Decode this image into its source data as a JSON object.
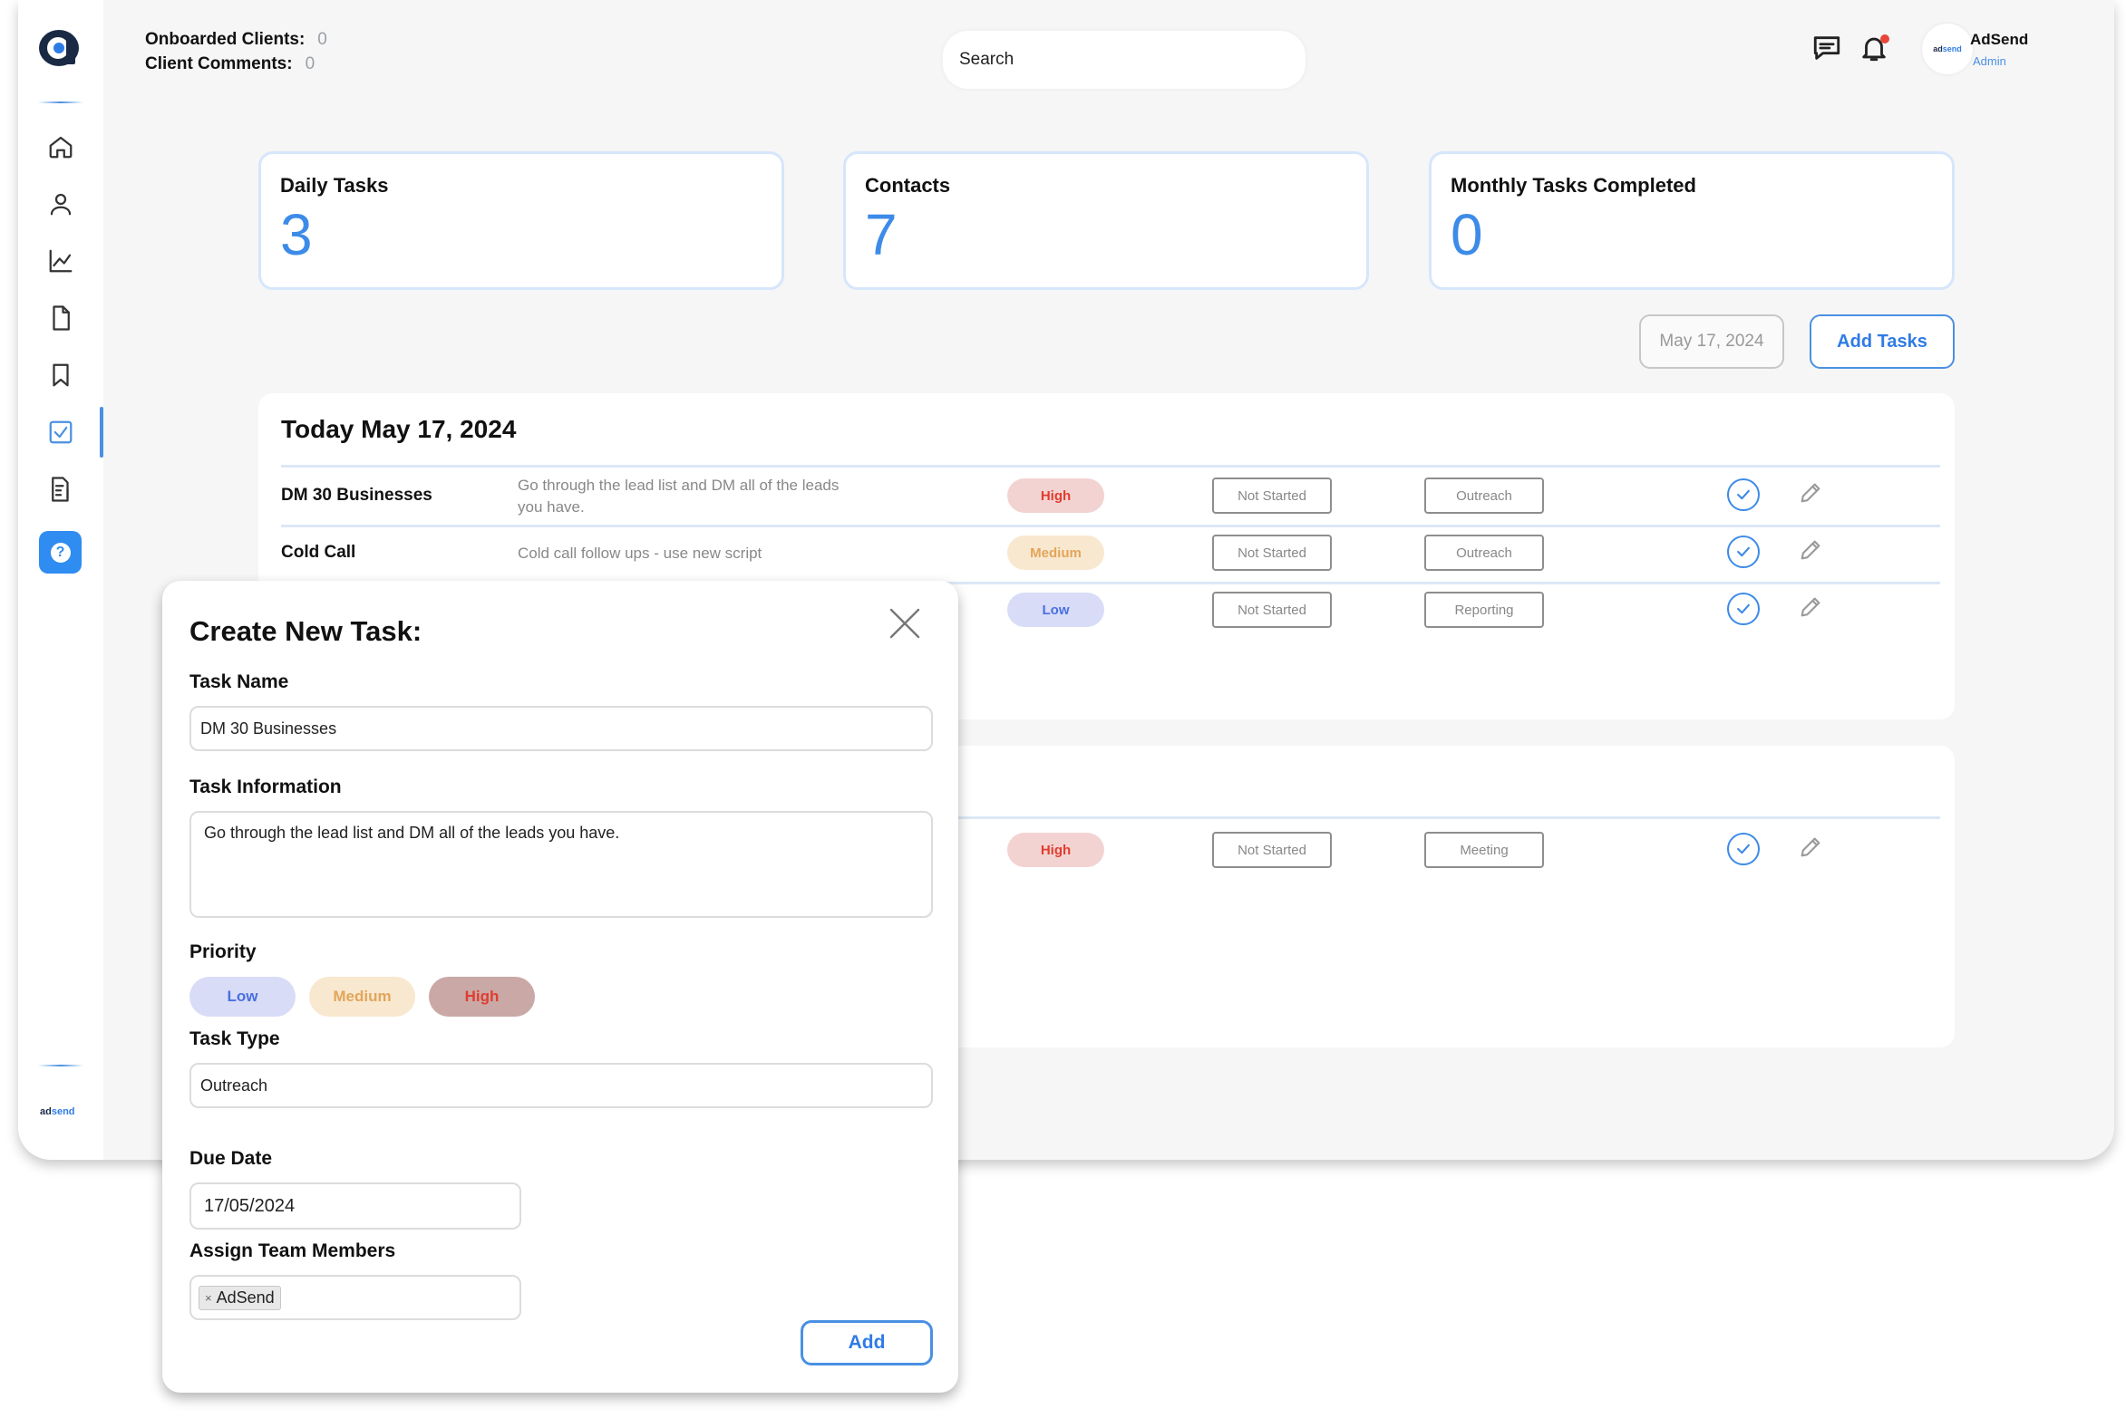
{
  "header": {
    "onboarded_label": "Onboarded Clients:",
    "onboarded_value": "0",
    "comments_label": "Client Comments:",
    "comments_value": "0",
    "search_text": "Search",
    "user_name": "AdSend",
    "user_role": "Admin",
    "avatar_brand_a": "ad",
    "avatar_brand_b": "send"
  },
  "sidebar": {
    "items": [
      "home-icon",
      "user-icon",
      "chart-icon",
      "document-icon",
      "bookmark-icon",
      "tasks-icon",
      "invoice-icon"
    ],
    "active": "tasks-icon",
    "help": "?",
    "brand_a": "ad",
    "brand_b": "send"
  },
  "stats": {
    "daily_label": "Daily Tasks",
    "daily_value": "3",
    "contacts_label": "Contacts",
    "contacts_value": "7",
    "monthly_label": "Monthly Tasks Completed",
    "monthly_value": "0"
  },
  "actions": {
    "date": "May 17, 2024",
    "add_tasks": "Add Tasks"
  },
  "today": {
    "title": "Today May 17, 2024",
    "rows": [
      {
        "name": "DM 30 Businesses",
        "info": "Go through the lead list and DM all of the leads you have.",
        "priority": "High",
        "status": "Not Started",
        "type": "Outreach"
      },
      {
        "name": "Cold Call",
        "info": "Cold call follow ups - use new script",
        "priority": "Medium",
        "status": "Not Started",
        "type": "Outreach"
      },
      {
        "name": "",
        "info": "",
        "priority": "Low",
        "status": "Not Started",
        "type": "Reporting"
      }
    ]
  },
  "upcoming": {
    "rows": [
      {
        "priority": "High",
        "status": "Not Started",
        "type": "Meeting"
      }
    ]
  },
  "modal": {
    "title": "Create New Task:",
    "task_name_label": "Task Name",
    "task_name_value": "DM 30 Businesses",
    "task_info_label": "Task Information",
    "task_info_value": "Go through the lead list and DM all of the leads you have.",
    "priority_label": "Priority",
    "priority_low": "Low",
    "priority_medium": "Medium",
    "priority_high": "High",
    "task_type_label": "Task Type",
    "task_type_value": "Outreach",
    "due_date_label": "Due Date",
    "due_date_value": "17/05/2024",
    "assign_label": "Assign Team Members",
    "assign_tag_x": "×",
    "assign_tag": "AdSend",
    "add_button": "Add"
  },
  "colors": {
    "accent": "#3d8be8",
    "high": "#e13d2f",
    "medium": "#e2a55a",
    "low": "#4a6fe0"
  }
}
